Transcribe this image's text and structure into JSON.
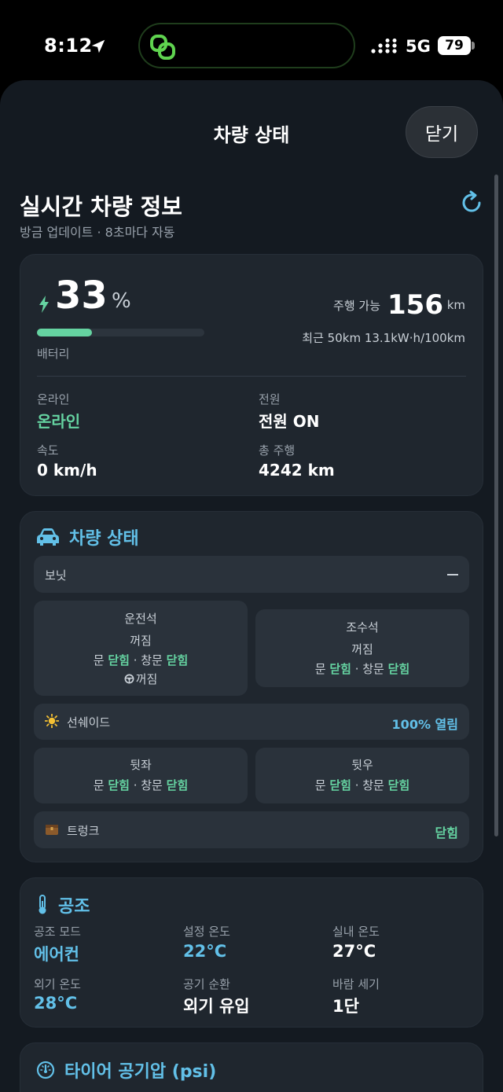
{
  "status_bar": {
    "time": "8:12",
    "network": "5G",
    "battery": "79"
  },
  "sheet": {
    "title": "차량 상태",
    "close_label": "닫기"
  },
  "header": {
    "title": "실시간 차량 정보",
    "subtitle": "방금 업데이트 · 8초마다 자동"
  },
  "battery_card": {
    "percent": "33",
    "percent_unit": "%",
    "level": 0.33,
    "label": "배터리",
    "range_label": "주행 가능",
    "range_value": "156",
    "range_unit": "km",
    "recent": "최근 50km 13.1kW·h/100km",
    "online_label": "온라인",
    "online_value": "온라인",
    "power_label": "전원",
    "power_value": "전원 ON",
    "speed_label": "속도",
    "speed_value": "0 km/h",
    "odometer_label": "총 주행",
    "odometer_value": "4242 km"
  },
  "vehicle_status": {
    "title": "차량 상태",
    "bonnet_label": "보닛",
    "driver": {
      "title": "운전석",
      "state": "꺼짐",
      "door_label": "문",
      "door_value": "닫힘",
      "window_label": "창문",
      "window_value": "닫힘",
      "wheel_state": "꺼짐"
    },
    "passenger": {
      "title": "조수석",
      "state": "꺼짐",
      "door_label": "문",
      "door_value": "닫힘",
      "window_label": "창문",
      "window_value": "닫힘"
    },
    "sunshade_label": "선쉐이드",
    "sunshade_value": "100% 열림",
    "rear_left": {
      "title": "뒷좌",
      "door_label": "문",
      "door_value": "닫힘",
      "window_label": "창문",
      "window_value": "닫힘"
    },
    "rear_right": {
      "title": "뒷우",
      "door_label": "문",
      "door_value": "닫힘",
      "window_label": "창문",
      "window_value": "닫힘"
    },
    "trunk_label": "트렁크",
    "trunk_value": "닫힘"
  },
  "climate": {
    "title": "공조",
    "mode_label": "공조 모드",
    "mode_value": "에어컨",
    "set_temp_label": "설정 온도",
    "set_temp_value": "22°C",
    "cabin_temp_label": "실내 온도",
    "cabin_temp_value": "27°C",
    "outside_temp_label": "외기 온도",
    "outside_temp_value": "28°C",
    "circulation_label": "공기 순환",
    "circulation_value": "외기 유입",
    "fan_label": "바람 세기",
    "fan_value": "1단"
  },
  "tires": {
    "title": "타이어 공기압 (psi)"
  },
  "colors": {
    "accent_green": "#65d3a1",
    "accent_blue": "#62c0e8",
    "card_bg": "#1f262e",
    "sheet_bg": "#141a21"
  }
}
